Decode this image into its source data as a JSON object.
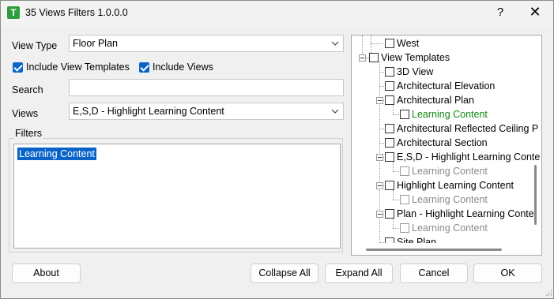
{
  "window": {
    "title": "35 Views Filters 1.0.0.0",
    "app_icon_letter": "T",
    "help_glyph": "?",
    "close_glyph": "✕"
  },
  "form": {
    "view_type_label": "View Type",
    "view_type_value": "Floor Plan",
    "include_view_templates_label": "Include View Templates",
    "include_view_templates_checked": true,
    "include_views_label": "Include Views",
    "include_views_checked": true,
    "search_label": "Search",
    "search_value": "",
    "views_label": "Views",
    "views_value": "E,S,D - Highlight Learning Content"
  },
  "filters": {
    "group_label": "Filters",
    "items": [
      "Learning Content"
    ],
    "selected_index": 0
  },
  "tree": {
    "rows": [
      {
        "label": "West",
        "style": "normal"
      },
      {
        "label": "View Templates",
        "style": "normal"
      },
      {
        "label": "3D View",
        "style": "normal"
      },
      {
        "label": "Architectural Elevation",
        "style": "normal"
      },
      {
        "label": "Architectural Plan",
        "style": "normal"
      },
      {
        "label": "Learning Content",
        "style": "green"
      },
      {
        "label": "Architectural Reflected Ceiling P",
        "style": "normal"
      },
      {
        "label": "Architectural Section",
        "style": "normal"
      },
      {
        "label": "E,S,D - Highlight Learning Conte",
        "style": "normal"
      },
      {
        "label": "Learning Content",
        "style": "gray"
      },
      {
        "label": "Highlight Learning Content",
        "style": "normal"
      },
      {
        "label": "Learning Content",
        "style": "gray"
      },
      {
        "label": "Plan - Highlight Learning Conte",
        "style": "normal"
      },
      {
        "label": "Learning Content",
        "style": "gray"
      },
      {
        "label": "Site Plan",
        "style": "normal"
      }
    ]
  },
  "buttons": {
    "about": "About",
    "collapse_all": "Collapse All",
    "expand_all": "Expand All",
    "cancel": "Cancel",
    "ok": "OK"
  },
  "colors": {
    "accent": "#0a64c8",
    "applied_filter": "#118a11",
    "inactive_filter": "#8a8a8a"
  }
}
